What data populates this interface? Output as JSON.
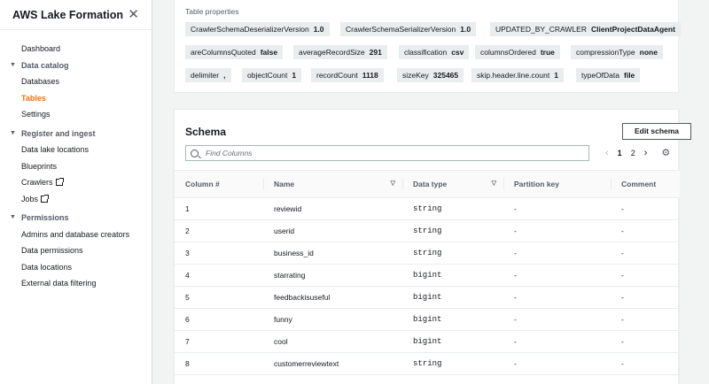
{
  "sidebar": {
    "title": "AWS Lake Formation",
    "close": "✕",
    "items": [
      {
        "type": "item",
        "label": "Dashboard"
      },
      {
        "type": "section",
        "label": "Data catalog"
      },
      {
        "type": "item",
        "label": "Databases"
      },
      {
        "type": "item",
        "label": "Tables",
        "active": true
      },
      {
        "type": "item",
        "label": "Settings"
      },
      {
        "type": "section",
        "label": "Register and ingest"
      },
      {
        "type": "item",
        "label": "Data lake locations"
      },
      {
        "type": "item",
        "label": "Blueprints"
      },
      {
        "type": "item",
        "label": "Crawlers",
        "external": true
      },
      {
        "type": "item",
        "label": "Jobs",
        "external": true
      },
      {
        "type": "section",
        "label": "Permissions"
      },
      {
        "type": "item",
        "label": "Admins and database creators"
      },
      {
        "type": "item",
        "label": "Data permissions"
      },
      {
        "type": "item",
        "label": "Data locations"
      },
      {
        "type": "item",
        "label": "External data filtering"
      }
    ]
  },
  "table_properties": {
    "label": "Table properties",
    "rows": [
      [
        {
          "key": "CrawlerSchemaDeserializerVersion",
          "value": "1.0"
        },
        {
          "key": "CrawlerSchemaSerializerVersion",
          "value": "1.0"
        },
        {
          "key": "UPDATED_BY_CRAWLER",
          "value": "ClientProjectDataAgent"
        }
      ],
      [
        {
          "key": "areColumnsQuoted",
          "value": "false"
        },
        {
          "key": "averageRecordSize",
          "value": "291"
        },
        {
          "key": "classification",
          "value": "csv"
        },
        {
          "key": "columnsOrdered",
          "value": "true"
        },
        {
          "key": "compressionType",
          "value": "none"
        }
      ],
      [
        {
          "key": "delimiter",
          "value": ","
        },
        {
          "key": "objectCount",
          "value": "1"
        },
        {
          "key": "recordCount",
          "value": "1118"
        },
        {
          "key": "sizeKey",
          "value": "325465"
        },
        {
          "key": "skip.header.line.count",
          "value": "1"
        },
        {
          "key": "typeOfData",
          "value": "file"
        }
      ]
    ]
  },
  "schema": {
    "title": "Schema",
    "edit_button": "Edit schema",
    "search_placeholder": "Find Columns",
    "pagination": {
      "prev": "‹",
      "pages": [
        "1",
        "2"
      ],
      "current": "1",
      "next": "›"
    },
    "settings_icon": "gear-icon",
    "columns": [
      "Column #",
      "Name",
      "Data type",
      "Partition key",
      "Comment"
    ],
    "rows": [
      [
        "1",
        "reviewid",
        "string",
        "-",
        "-"
      ],
      [
        "2",
        "userid",
        "string",
        "-",
        "-"
      ],
      [
        "3",
        "business_id",
        "string",
        "-",
        "-"
      ],
      [
        "4",
        "starrating",
        "bigint",
        "-",
        "-"
      ],
      [
        "5",
        "feedbackisuseful",
        "bigint",
        "-",
        "-"
      ],
      [
        "6",
        "funny",
        "bigint",
        "-",
        "-"
      ],
      [
        "7",
        "cool",
        "bigint",
        "-",
        "-"
      ],
      [
        "8",
        "customerreviewtext",
        "string",
        "-",
        "-"
      ]
    ]
  },
  "colors": {
    "accent": "#ec7211",
    "text": "#16191f",
    "muted": "#545b64"
  }
}
